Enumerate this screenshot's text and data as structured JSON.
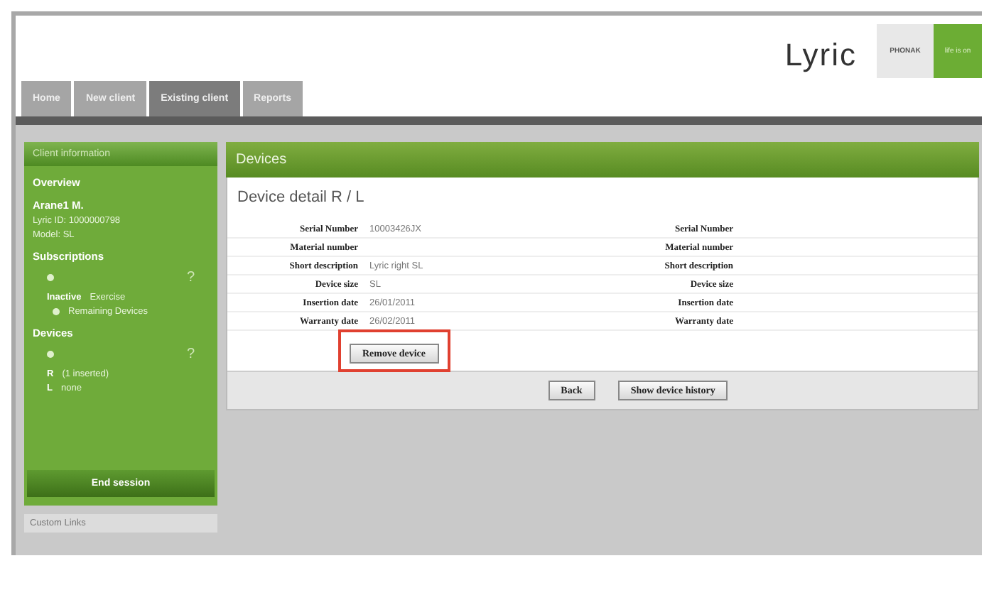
{
  "header": {
    "logo": "Lyric",
    "brand": "PHONAK",
    "tagline": "life is on"
  },
  "tabs": [
    {
      "label": "Home",
      "selected": false
    },
    {
      "label": "New client",
      "selected": false
    },
    {
      "label": "Existing client",
      "selected": true
    },
    {
      "label": "Reports",
      "selected": false
    }
  ],
  "sidebar": {
    "title": "Client information",
    "overview": "Overview",
    "client_name": "Arane1 M.",
    "client_id": "Lyric ID: 1000000798",
    "client_note": "Model: SL",
    "subscriptions": {
      "heading": "Subscriptions",
      "help": "?",
      "status": "Inactive",
      "status_note": "Exercise",
      "item": "Remaining Devices"
    },
    "devices": {
      "heading": "Devices",
      "help": "?",
      "items": [
        {
          "marker": "R",
          "label": "(1 inserted)"
        },
        {
          "marker": "L",
          "label": "none"
        }
      ]
    },
    "end_button": "End session",
    "custom_links": "Custom Links"
  },
  "panel": {
    "title": "Devices",
    "heading": "Device detail R / L",
    "rows": [
      {
        "label": "Serial Number",
        "value": "10003426JX",
        "label_right": "Serial Number"
      },
      {
        "label": "Material number",
        "value": "",
        "label_right": "Material number"
      },
      {
        "label": "Short description",
        "value": "Lyric right SL",
        "label_right": "Short description"
      },
      {
        "label": "Device size",
        "value": "SL",
        "label_right": "Device size"
      },
      {
        "label": "Insertion date",
        "value": "26/01/2011",
        "label_right": "Insertion date"
      },
      {
        "label": "Warranty date",
        "value": "26/02/2011",
        "label_right": "Warranty date"
      }
    ],
    "remove_button": {
      "label": "Remove device",
      "highlighted": true
    },
    "buttons": [
      "Back",
      "Show device history"
    ]
  }
}
